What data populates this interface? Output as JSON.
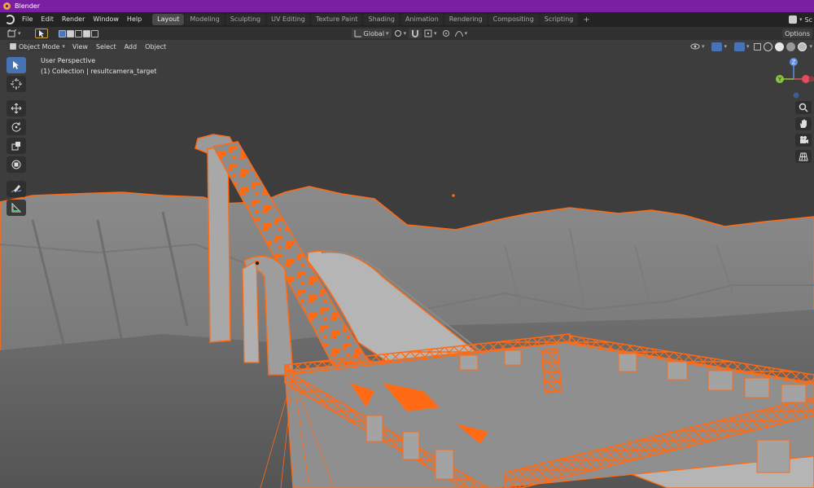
{
  "window": {
    "title": "Blender"
  },
  "menubar": {
    "menus": [
      "File",
      "Edit",
      "Render",
      "Window",
      "Help"
    ],
    "tabs": [
      "Layout",
      "Modeling",
      "Sculpting",
      "UV Editing",
      "Texture Paint",
      "Shading",
      "Animation",
      "Rendering",
      "Compositing",
      "Scripting"
    ],
    "active_tab": "Layout",
    "add_tab": "+",
    "scene_label": "Sc"
  },
  "toolheader": {
    "transform_orientation": "Global",
    "options_label": "Options"
  },
  "viewheader": {
    "mode": "Object Mode",
    "menus": [
      "View",
      "Select",
      "Add",
      "Object"
    ]
  },
  "viewport": {
    "perspective_label": "User Perspective",
    "collection_label": "(1) Collection | resultcamera_target",
    "selection_color": "#ff6a14",
    "background_color": "#3d3d3d"
  },
  "gizmo": {
    "z": "Z",
    "y": "Y"
  },
  "tools": [
    "select-box-icon",
    "cursor-icon",
    "move-icon",
    "rotate-icon",
    "scale-icon",
    "transform-icon",
    "annotate-icon",
    "measure-icon"
  ],
  "nav_icons": [
    "zoom-icon",
    "pan-hand-icon",
    "camera-view-icon",
    "ortho-grid-icon"
  ]
}
